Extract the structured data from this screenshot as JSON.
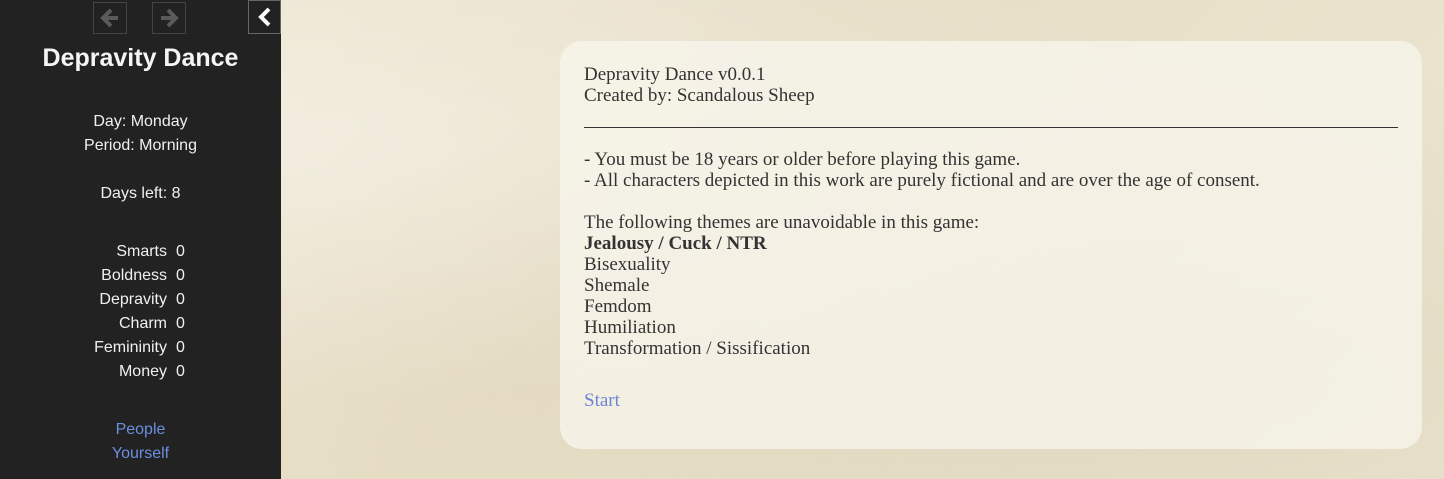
{
  "sidebar": {
    "title": "Depravity Dance",
    "day": "Day: Monday",
    "period": "Period: Morning",
    "days_left": "Days left: 8",
    "stats": [
      {
        "name": "Smarts",
        "value": "0"
      },
      {
        "name": "Boldness",
        "value": "0"
      },
      {
        "name": "Depravity",
        "value": "0"
      },
      {
        "name": "Charm",
        "value": "0"
      },
      {
        "name": "Femininity",
        "value": "0"
      },
      {
        "name": "Money",
        "value": "0"
      }
    ],
    "links": [
      "People",
      "Yourself"
    ],
    "icons": {
      "back": "arrow-left-icon",
      "forward": "arrow-right-icon",
      "collapse": "chevron-left-icon"
    }
  },
  "passage": {
    "version": "Depravity Dance v0.0.1",
    "credit": "Created by: Scandalous Sheep",
    "warnings": [
      "- You must be 18 years or older before playing this game.",
      "- All characters depicted in this work are purely fictional and are over the age of consent."
    ],
    "themes_intro": "The following themes are unavoidable in this game:",
    "themes_bold": "Jealousy / Cuck / NTR",
    "themes": [
      "Bisexuality",
      "Shemale",
      "Femdom",
      "Humiliation",
      "Transformation / Sissification"
    ],
    "start_label": "Start"
  },
  "colors": {
    "sidebar_bg": "#222222",
    "link": "#6b8fe0",
    "background": "#ece4cf"
  }
}
